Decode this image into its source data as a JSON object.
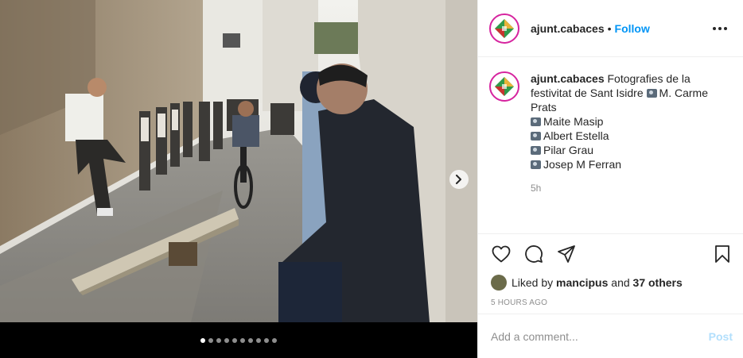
{
  "post": {
    "username": "ajunt.cabaces",
    "separator": "•",
    "follow_label": "Follow",
    "more_icon": "more-horizontal-icon",
    "caption": {
      "username": "ajunt.cabaces",
      "lines": [
        "Fotografies de la festivitat de Sant Isidre",
        "M. Carme Prats",
        "Maite Masip",
        "Albert Estella",
        "Pilar Grau",
        "Josep M Ferran"
      ],
      "time": "5h"
    },
    "actions": {
      "like_icon": "heart-icon",
      "comment_icon": "comment-icon",
      "share_icon": "share-icon",
      "save_icon": "bookmark-icon"
    },
    "likes": {
      "prefix": "Liked by",
      "user": "mancipus",
      "and": "and",
      "others": "37 others"
    },
    "posted_ago": "5 hours ago",
    "comment_box": {
      "placeholder": "Add a comment...",
      "post_label": "Post"
    }
  },
  "carousel": {
    "total_slides": 10,
    "current_slide": 1,
    "next_icon": "chevron-right-icon"
  },
  "colors": {
    "accent": "#0095f6",
    "post_disabled": "#b2dffc",
    "muted": "#8e8e8e",
    "avatar_ring": "#d6249f"
  }
}
